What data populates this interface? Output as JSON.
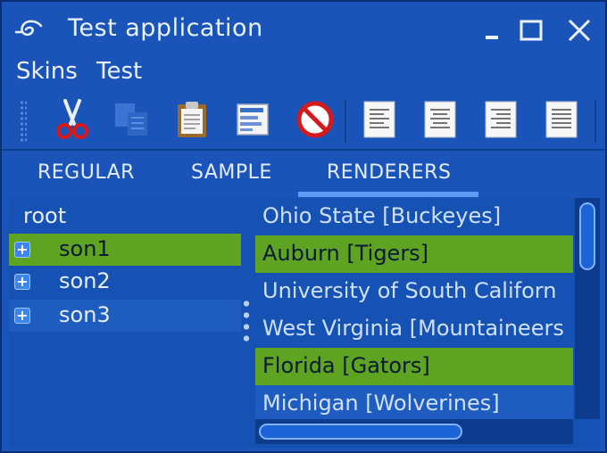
{
  "window": {
    "title": "Test application"
  },
  "menu": {
    "items": [
      "Skins",
      "Test"
    ]
  },
  "toolbar": {
    "tools": [
      "cut-icon",
      "copy-icon",
      "paste-icon",
      "properties-icon",
      "stop-icon",
      "align-left-icon",
      "align-center-icon",
      "align-right-icon",
      "align-justify-icon"
    ]
  },
  "tabs": {
    "items": [
      "REGULAR",
      "SAMPLE",
      "RENDERERS"
    ],
    "selected": "RENDERERS"
  },
  "tree": {
    "root": "root",
    "children": [
      "son1",
      "son2",
      "son3"
    ],
    "selected": "son1"
  },
  "list": {
    "items": [
      "Ohio State [Buckeyes]",
      "Auburn [Tigers]",
      "University of South Californ",
      "West Virginia [Mountaineers",
      "Florida [Gators]",
      "Michigan [Wolverines]"
    ],
    "selected": [
      "Auburn [Tigers]",
      "Florida [Gators]"
    ]
  },
  "colors": {
    "background": "#1a54b8",
    "selection": "#5ea322",
    "accent": "#5f9bf2"
  }
}
